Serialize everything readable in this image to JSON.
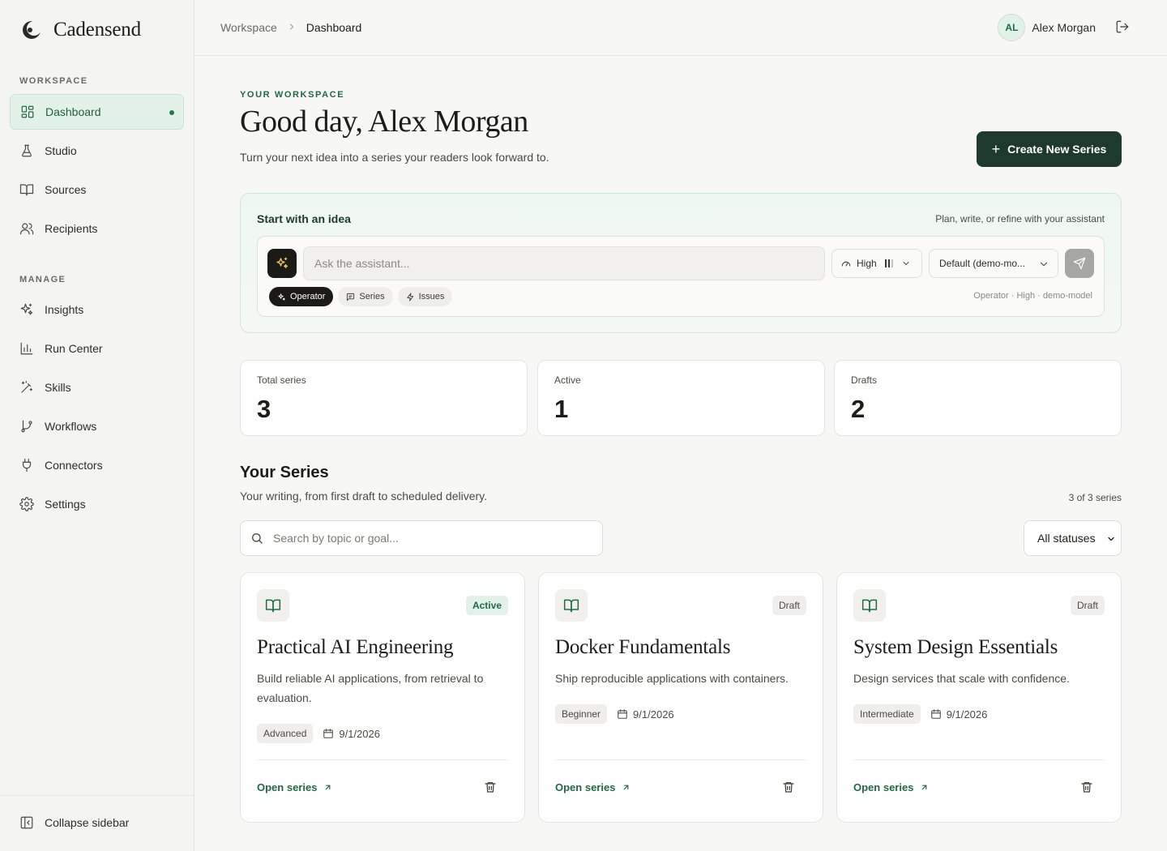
{
  "app": {
    "name": "Cadensend"
  },
  "sidebar": {
    "workspace_label": "WORKSPACE",
    "manage_label": "MANAGE",
    "workspace_items": [
      {
        "label": "Dashboard",
        "icon": "dashboard-grid-icon",
        "active": true
      },
      {
        "label": "Studio",
        "icon": "flask-icon"
      },
      {
        "label": "Sources",
        "icon": "open-book-icon"
      },
      {
        "label": "Recipients",
        "icon": "users-icon"
      }
    ],
    "manage_items": [
      {
        "label": "Insights",
        "icon": "sparkles-icon"
      },
      {
        "label": "Run Center",
        "icon": "bar-chart-icon"
      },
      {
        "label": "Skills",
        "icon": "magic-wand-icon"
      },
      {
        "label": "Workflows",
        "icon": "git-branch-icon"
      },
      {
        "label": "Connectors",
        "icon": "plug-icon"
      },
      {
        "label": "Settings",
        "icon": "gear-icon"
      }
    ],
    "collapse_label": "Collapse sidebar"
  },
  "topbar": {
    "breadcrumb": [
      "Workspace",
      "Dashboard"
    ],
    "user_initials": "AL",
    "user_name": "Alex Morgan"
  },
  "hero": {
    "eyebrow": "YOUR WORKSPACE",
    "greeting": "Good day, Alex Morgan",
    "subtitle": "Turn your next idea into a series your readers look forward to.",
    "create_button": "Create New Series"
  },
  "assistant": {
    "title": "Start with an idea",
    "hint": "Plan, write, or refine with your assistant",
    "input_placeholder": "Ask the assistant...",
    "effort": "High",
    "model": "Default (demo-mo...",
    "modes": [
      "Operator",
      "Series",
      "Issues"
    ],
    "active_mode": "Operator",
    "meta": "Operator · High · demo-model"
  },
  "stats": [
    {
      "label": "Total series",
      "value": "3"
    },
    {
      "label": "Active",
      "value": "1"
    },
    {
      "label": "Drafts",
      "value": "2"
    }
  ],
  "series_section": {
    "title": "Your Series",
    "subtitle": "Your writing, from first draft to scheduled delivery.",
    "count": "3 of 3 series",
    "search_placeholder": "Search by topic or goal...",
    "status_filter": "All statuses",
    "open_label": "Open series",
    "cards": [
      {
        "status": "Active",
        "title": "Practical AI Engineering",
        "description": "Build reliable AI applications, from retrieval to evaluation.",
        "level": "Advanced",
        "date": "9/1/2026"
      },
      {
        "status": "Draft",
        "title": "Docker Fundamentals",
        "description": "Ship reproducible applications with containers.",
        "level": "Beginner",
        "date": "9/1/2026"
      },
      {
        "status": "Draft",
        "title": "System Design Essentials",
        "description": "Design services that scale with confidence.",
        "level": "Intermediate",
        "date": "9/1/2026"
      }
    ]
  },
  "colors": {
    "accent": "#1f6a45",
    "primary_button": "#1e3a2c",
    "active_nav_bg": "#e3f2e8",
    "background": "#f7f7f5"
  }
}
